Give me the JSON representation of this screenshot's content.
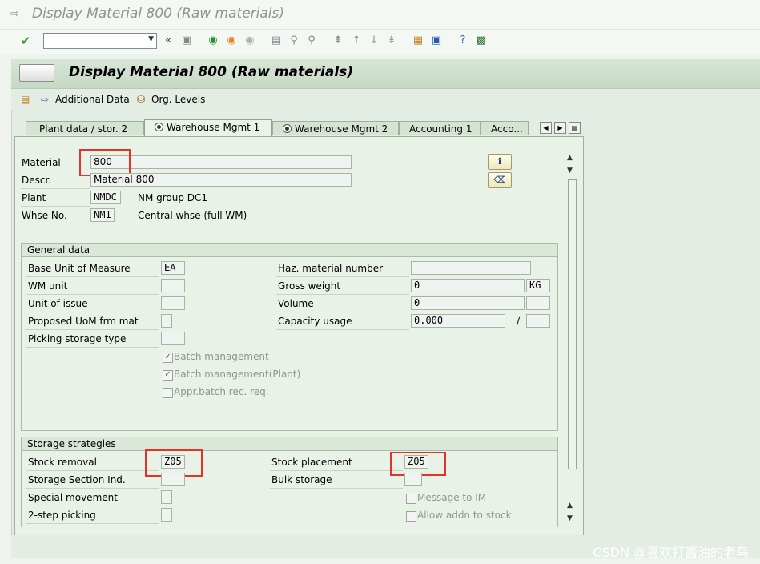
{
  "title": "Display Material 800 (Raw materials)",
  "header_title": "Display Material 800 (Raw materials)",
  "app_toolbar": {
    "additional_data": "Additional Data",
    "org_levels": "Org. Levels"
  },
  "system_toolbar": {
    "back_chevrons": "«"
  },
  "tabs": [
    {
      "label": "Plant data / stor. 2"
    },
    {
      "label": "Warehouse Mgmt 1"
    },
    {
      "label": "Warehouse Mgmt 2"
    },
    {
      "label": "Accounting 1"
    },
    {
      "label": "Acco..."
    }
  ],
  "header_fields": {
    "material_label": "Material",
    "material_value": "800",
    "descr_label": "Descr.",
    "descr_value": "Material 800",
    "plant_label": "Plant",
    "plant_value": "NMDC",
    "plant_text": "NM group DC1",
    "whse_label": "Whse No.",
    "whse_value": "NM1",
    "whse_text": "Central whse (full WM)"
  },
  "general_data": {
    "title": "General data",
    "base_uom_label": "Base Unit of Measure",
    "base_uom_value": "EA",
    "wm_unit_label": "WM unit",
    "wm_unit_value": "",
    "unit_issue_label": "Unit of issue",
    "unit_issue_value": "",
    "proposed_uom_label": "Proposed UoM frm mat",
    "picking_type_label": "Picking storage type",
    "haz_label": "Haz. material number",
    "haz_value": "",
    "gross_weight_label": "Gross weight",
    "gross_weight_value": "0",
    "gross_weight_unit": "KG",
    "volume_label": "Volume",
    "volume_value": "0",
    "capacity_label": "Capacity usage",
    "capacity_value": "0.000",
    "capacity_sep": "/",
    "batch_mgmt": "Batch management",
    "batch_mgmt_plant": "Batch management(Plant)",
    "appr_batch": "Appr.batch rec. req."
  },
  "storage_strategies": {
    "title": "Storage strategies",
    "stock_removal_label": "Stock removal",
    "stock_removal_value": "Z05",
    "stock_placement_label": "Stock placement",
    "stock_placement_value": "Z05",
    "storage_section_label": "Storage Section Ind.",
    "bulk_storage_label": "Bulk storage",
    "special_movement_label": "Special movement",
    "two_step_label": "2-step picking",
    "message_im": "Message to IM",
    "allow_addn": "Allow addn to stock"
  },
  "watermark": "CSDN @喜欢打酱油的老鸟",
  "colors": {
    "highlight": "#e2332b",
    "background": "#e3ede3"
  }
}
